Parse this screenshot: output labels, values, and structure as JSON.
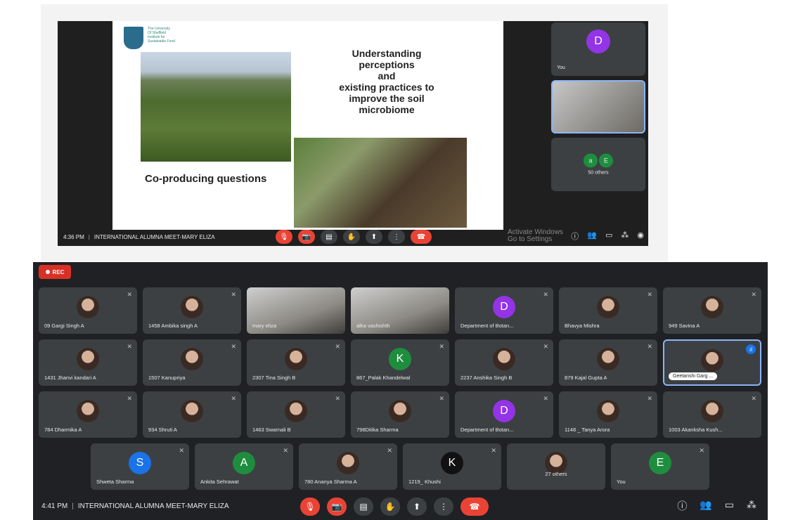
{
  "top": {
    "slide": {
      "university": "The University\nOf Sheffield\nInstitute for\nSustainable Food",
      "title": "Understanding\nperceptions\nand\nexisting practices to\nimprove the soil\nmicrobiome",
      "subtitle": "Co-producing questions"
    },
    "tiles": [
      {
        "initial": "D",
        "name": "You"
      },
      {
        "initial": "",
        "name": ""
      },
      {
        "others": "50 others",
        "initials": [
          "a",
          "E"
        ]
      }
    ],
    "bar": {
      "time": "4:36 PM",
      "meeting": "INTERNATIONAL ALUMNA MEET-MARY ELIZA"
    },
    "watermark": "Activate Windows\nGo to Settings"
  },
  "bottom": {
    "rec_label": "REC",
    "rows": [
      [
        {
          "name": "09 Gargi Singh A",
          "type": "photo"
        },
        {
          "name": "1458 Ambika singh A",
          "type": "photo"
        },
        {
          "name": "mary eliza",
          "type": "video"
        },
        {
          "name": "alka vashishth",
          "type": "video"
        },
        {
          "name": "Department of Botan...",
          "type": "initial",
          "initial": "D",
          "color": "#9334e6"
        },
        {
          "name": "Bhavya Mishra",
          "type": "photo"
        },
        {
          "name": "949 Savina A",
          "type": "photo"
        }
      ],
      [
        {
          "name": "1431 Jhanvi kandari A",
          "type": "photo"
        },
        {
          "name": "1507 Kanupriya",
          "type": "photo"
        },
        {
          "name": "2307 Tina Singh B",
          "type": "photo"
        },
        {
          "name": "867_Palak Khandelwal",
          "type": "initial",
          "initial": "K",
          "color": "#1e8e3e"
        },
        {
          "name": "2237 Anshika Singh B",
          "type": "photo"
        },
        {
          "name": "879 Kajal Gupta A",
          "type": "photo"
        },
        {
          "name": "Geetanshi Garg ...",
          "type": "photo",
          "active": true
        }
      ],
      [
        {
          "name": "784 Dharmika A",
          "type": "photo"
        },
        {
          "name": "934 Shruti A",
          "type": "photo"
        },
        {
          "name": "1463 Swarnali B",
          "type": "photo"
        },
        {
          "name": "798Ditika Sharma",
          "type": "photo"
        },
        {
          "name": "Department of Botan...",
          "type": "initial",
          "initial": "D",
          "color": "#9334e6"
        },
        {
          "name": "1148 _ Tanya Arora",
          "type": "photo"
        },
        {
          "name": "1003 Akanksha Kush...",
          "type": "photo"
        }
      ],
      [
        {
          "name": "Shweta Sharma",
          "type": "initial",
          "initial": "S",
          "color": "#1a73e8"
        },
        {
          "name": "Ankita Sehrawat",
          "type": "initial",
          "initial": "A",
          "color": "#1e8e3e"
        },
        {
          "name": "780 Ananya Sharma A",
          "type": "photo"
        },
        {
          "name": "1219_ Khushi",
          "type": "initial",
          "initial": "K",
          "color": "#111111"
        },
        {
          "name": "27 others",
          "type": "photo"
        },
        {
          "name": "You",
          "type": "initial",
          "initial": "E",
          "color": "#1e8e3e"
        }
      ]
    ],
    "bar": {
      "time": "4:41 PM",
      "meeting": "INTERNATIONAL ALUMNA MEET-MARY ELIZA"
    }
  }
}
